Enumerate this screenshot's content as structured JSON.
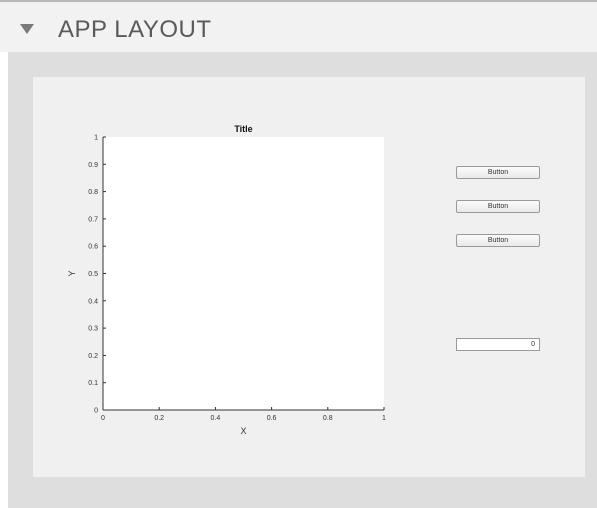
{
  "section": {
    "title": "APP LAYOUT",
    "toggle_icon": "collapse-triangle-icon"
  },
  "app": {
    "buttons": [
      {
        "label": "Button"
      },
      {
        "label": "Button"
      },
      {
        "label": "Button"
      }
    ],
    "numeric_field": {
      "value": "0"
    }
  },
  "chart_data": {
    "type": "line",
    "title": "Title",
    "xlabel": "X",
    "ylabel": "Y",
    "xlim": [
      0,
      1
    ],
    "ylim": [
      0,
      1
    ],
    "x_ticks": [
      "0",
      "0.2",
      "0.4",
      "0.6",
      "0.8",
      "1"
    ],
    "y_ticks": [
      "0",
      "0.1",
      "0.2",
      "0.3",
      "0.4",
      "0.5",
      "0.6",
      "0.7",
      "0.8",
      "0.9",
      "1"
    ],
    "series": [],
    "grid": false
  }
}
